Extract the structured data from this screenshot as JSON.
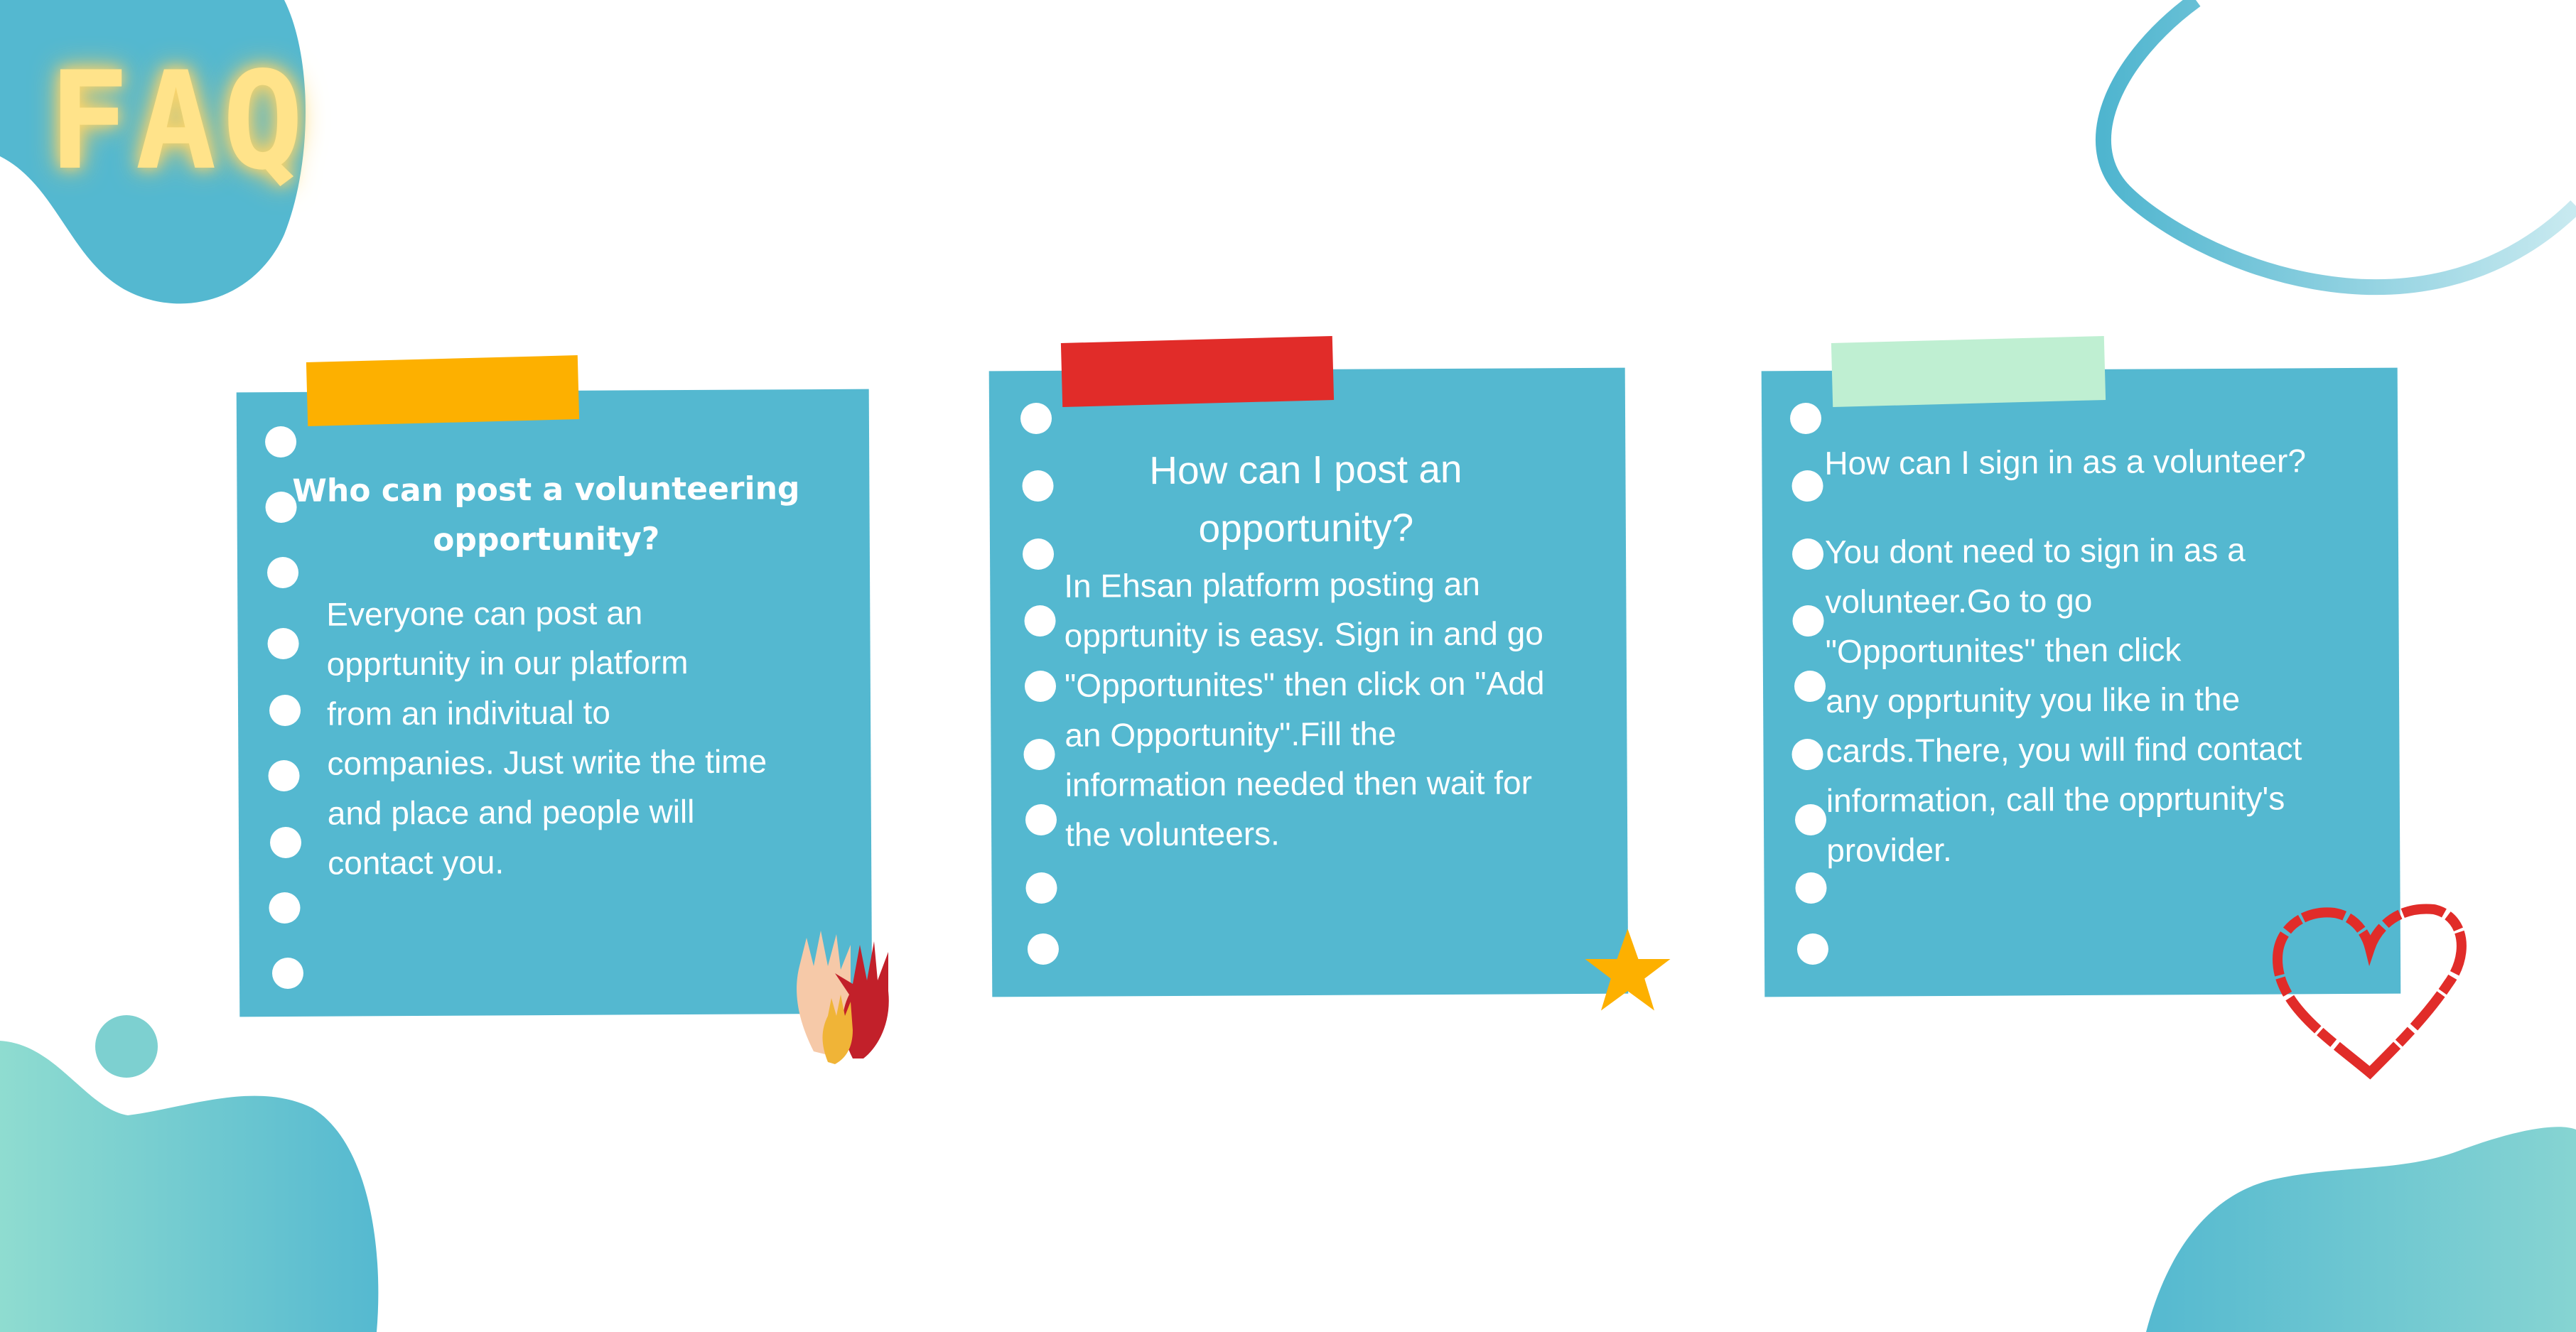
{
  "header": {
    "title": "FAQ"
  },
  "colors": {
    "card": "#54b8d0",
    "accent_teal": "#5bbccf",
    "faq_text": "#ffe38a",
    "tape1": "#fdb000",
    "tape2": "#e12c29",
    "tape3": "#bfefd2"
  },
  "faqs": [
    {
      "question": "Who can post a volunteering opportunity?",
      "answer": "Everyone can post an\nopprtunity in our platform\nfrom an indivitual to\ncompanies. Just write the time\nand place and people will\ncontact you.",
      "decoration": "hands-icon"
    },
    {
      "question": "How can I post an opportunity?",
      "answer": "In Ehsan platform posting an\nopprtunity is easy. Sign in and go\n\"Opportunites\" then click on \"Add\nan Opportunity\".Fill the\ninformation needed then wait for\nthe volunteers.",
      "decoration": "star-icon"
    },
    {
      "question": "How can I sign in as a volunteer?",
      "answer": "You dont need to sign in as a\nvolunteer.Go to  go\n \"Opportunites\" then click\nany opprtunity you like in the\ncards.There, you will find contact\n information, call the opprtunity's\n provider.",
      "decoration": "heart-icon"
    }
  ]
}
